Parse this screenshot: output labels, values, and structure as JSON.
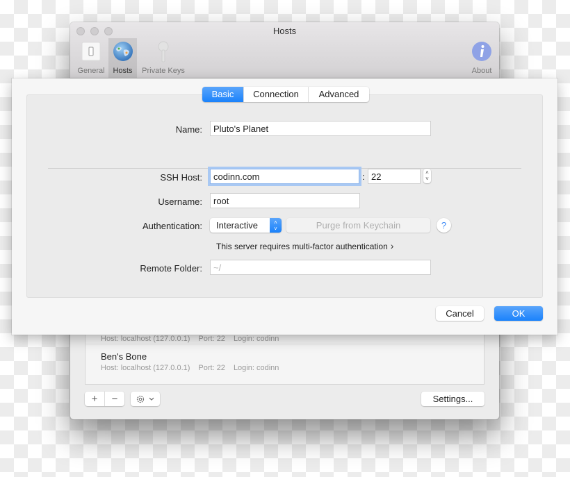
{
  "window": {
    "title": "Hosts",
    "toolbar": [
      {
        "label": "General",
        "icon": "switch-icon",
        "active": false
      },
      {
        "label": "Hosts",
        "icon": "globe-icon",
        "active": true
      },
      {
        "label": "Private Keys",
        "icon": "key-icon",
        "active": false
      },
      {
        "label": "About",
        "icon": "info-icon",
        "active": false
      }
    ]
  },
  "host_list": {
    "rows": [
      {
        "name": "",
        "host": "Host: localhost (127.0.0.1)",
        "port": "Port: 22",
        "login": "Login: codinn"
      },
      {
        "name": "Ben's Bone",
        "host": "Host: localhost (127.0.0.1)",
        "port": "Port: 22",
        "login": "Login: codinn"
      }
    ],
    "add_label": "+",
    "remove_label": "−",
    "action_icon": "gear-icon",
    "settings_label": "Settings..."
  },
  "sheet": {
    "tabs": [
      {
        "label": "Basic",
        "active": true
      },
      {
        "label": "Connection",
        "active": false
      },
      {
        "label": "Advanced",
        "active": false
      }
    ],
    "form": {
      "name_label": "Name:",
      "name_value": "Pluto's Planet",
      "ssh_host_label": "SSH Host:",
      "ssh_host_value": "codinn.com",
      "port_separator": ":",
      "port_value": "22",
      "username_label": "Username:",
      "username_value": "root",
      "auth_label": "Authentication:",
      "auth_value": "Interactive",
      "purge_label": "Purge from Keychain",
      "help_label": "?",
      "mfa_text": "This server requires multi-factor authentication",
      "mfa_chevron": "›",
      "remote_folder_label": "Remote Folder:",
      "remote_folder_value": "",
      "remote_folder_placeholder": "~/"
    },
    "cancel_label": "Cancel",
    "ok_label": "OK"
  },
  "colors": {
    "accent": "#1a82fb",
    "about_icon": "#8fa2e6"
  }
}
